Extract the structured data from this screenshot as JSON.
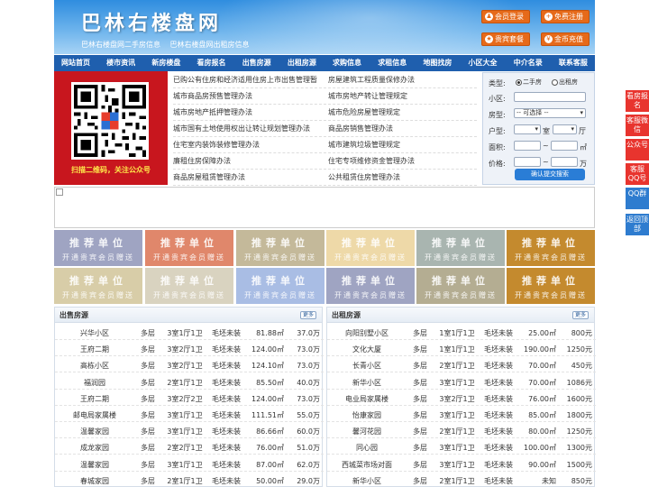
{
  "header": {
    "title": "巴林右楼盘网",
    "sub_links": [
      "巴林右楼盘网二手房信息",
      "巴林右楼盘网出租房信息"
    ],
    "buttons": [
      {
        "label": "会员登录",
        "icon": "user-icon"
      },
      {
        "label": "免费注册",
        "icon": "register-icon"
      },
      {
        "label": "贵宾套餐",
        "icon": "vip-icon"
      },
      {
        "label": "金币充值",
        "icon": "coin-icon"
      }
    ]
  },
  "nav": [
    "网站首页",
    "楼市资讯",
    "新房楼盘",
    "看房报名",
    "出售房源",
    "出租房源",
    "求购信息",
    "求租信息",
    "地图找房",
    "小区大全",
    "中介名录",
    "联系客服"
  ],
  "qr": {
    "caption": "扫描二维码，关注公众号"
  },
  "links": {
    "left": [
      "已购公有住房和经济适用住房上市出售管理暂",
      "城市商品房预售管理办法",
      "城市房地产抵押管理办法",
      "城市国有土地使用权出让转让规划管理办法",
      "住宅室内装饰装修管理办法",
      "廉租住房保障办法",
      "商品房屋租赁管理办法"
    ],
    "right": [
      "房屋建筑工程质量保修办法",
      "城市房地产转让管理规定",
      "城市危险房屋管理规定",
      "商品房销售管理办法",
      "城市建筑垃圾管理规定",
      "住宅专项维修资金管理办法",
      "公共租赁住房管理办法"
    ]
  },
  "search": {
    "type_label": "类型:",
    "type_options": [
      "二手房",
      "出租房"
    ],
    "community_label": "小区:",
    "layout_label": "房型:",
    "layout_select": "-- 可选择 --",
    "unit_label": "户型:",
    "room_unit": "室",
    "hall_unit": "厅",
    "area_label": "面积:",
    "area_unit": "㎡",
    "price_label": "价格:",
    "price_unit": "万",
    "range_sep": "~",
    "submit": "确认提交搜索"
  },
  "tiles": {
    "line1": "推荐单位",
    "line2": "开通贵宾会员赠送",
    "colors_row1": [
      "#9fa4c2",
      "#e0876b",
      "#c4b99a",
      "#eed9a8",
      "#a9b5b0",
      "#c48a2e"
    ],
    "colors_row2": [
      "#d8cda8",
      "#d9d3c0",
      "#a9bde4",
      "#9fa4c2",
      "#b4ad92",
      "#c48a2e"
    ]
  },
  "sale": {
    "title": "出售房源",
    "more": "更多",
    "rows": [
      [
        "兴华小区",
        "多层",
        "3室1厅1卫",
        "毛坯未装",
        "81.88㎡",
        "37.0万"
      ],
      [
        "王府二期",
        "多层",
        "3室2厅1卫",
        "毛坯未装",
        "124.00㎡",
        "73.0万"
      ],
      [
        "高栋小区",
        "多层",
        "3室2厅1卫",
        "毛坯未装",
        "124.10㎡",
        "73.0万"
      ],
      [
        "福润园",
        "多层",
        "2室1厅1卫",
        "毛坯未装",
        "85.50㎡",
        "40.0万"
      ],
      [
        "王府二期",
        "多层",
        "3室2厅2卫",
        "毛坯未装",
        "124.00㎡",
        "73.0万"
      ],
      [
        "邮电局家属楼",
        "多层",
        "3室1厅1卫",
        "毛坯未装",
        "111.51㎡",
        "55.0万"
      ],
      [
        "温馨家园",
        "多层",
        "3室1厅1卫",
        "毛坯未装",
        "86.66㎡",
        "60.0万"
      ],
      [
        "成龙家园",
        "多层",
        "2室2厅1卫",
        "毛坯未装",
        "76.00㎡",
        "51.0万"
      ],
      [
        "温馨家园",
        "多层",
        "3室1厅1卫",
        "毛坯未装",
        "87.00㎡",
        "62.0万"
      ],
      [
        "春城家园",
        "多层",
        "2室1厅1卫",
        "毛坯未装",
        "50.00㎡",
        "29.0万"
      ]
    ]
  },
  "rent": {
    "title": "出租房源",
    "more": "更多",
    "rows": [
      [
        "向阳别墅小区",
        "多层",
        "1室1厅1卫",
        "毛坯未装",
        "25.00㎡",
        "800元"
      ],
      [
        "文化大厦",
        "多层",
        "1室1厅1卫",
        "毛坯未装",
        "190.00㎡",
        "1250元"
      ],
      [
        "长青小区",
        "多层",
        "2室1厅1卫",
        "毛坯未装",
        "70.00㎡",
        "450元"
      ],
      [
        "新华小区",
        "多层",
        "3室1厅1卫",
        "毛坯未装",
        "70.00㎡",
        "1086元"
      ],
      [
        "电业局家属楼",
        "多层",
        "3室2厅1卫",
        "毛坯未装",
        "76.00㎡",
        "1600元"
      ],
      [
        "怡康家园",
        "多层",
        "3室1厅1卫",
        "毛坯未装",
        "85.00㎡",
        "1800元"
      ],
      [
        "馨河花园",
        "多层",
        "2室1厅1卫",
        "毛坯未装",
        "80.00㎡",
        "1250元"
      ],
      [
        "同心园",
        "多层",
        "3室1厅1卫",
        "毛坯未装",
        "100.00㎡",
        "1300元"
      ],
      [
        "西城菜市场对面",
        "多层",
        "3室1厅1卫",
        "毛坯未装",
        "90.00㎡",
        "1500元"
      ],
      [
        "新华小区",
        "多层",
        "2室1厅1卫",
        "毛坯未装",
        "未知",
        "850元"
      ]
    ]
  },
  "side": [
    {
      "text": "看房报名",
      "color": "red"
    },
    {
      "text": "客服微信",
      "color": "red"
    },
    {
      "text": "公众号",
      "color": "red"
    },
    {
      "text": "客服QQ号",
      "color": "red"
    },
    {
      "text": "QQ群",
      "color": "blue"
    },
    {
      "text": "返回顶部",
      "color": "blue"
    }
  ]
}
